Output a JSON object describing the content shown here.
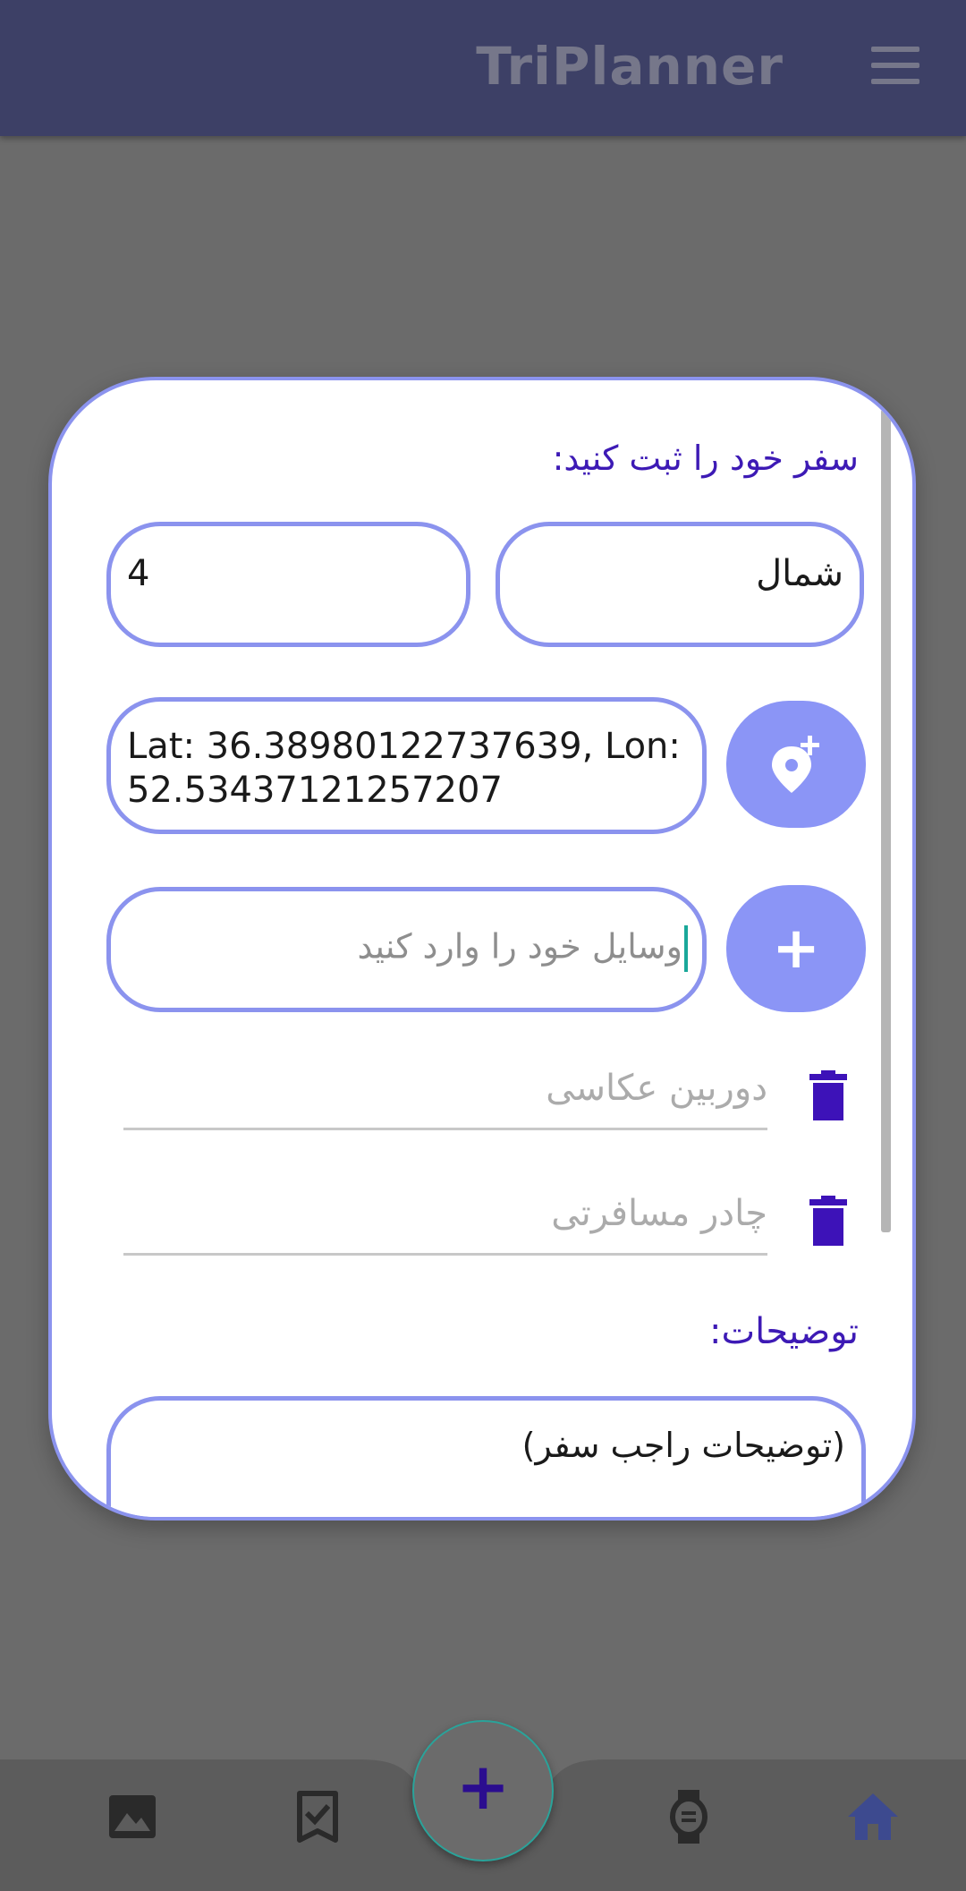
{
  "app": {
    "title": "TriPlanner"
  },
  "form": {
    "heading": "سفر خود را ثبت کنید:",
    "destination_value": "شمال",
    "count_value": "4",
    "location_value": "Lat: 36.38980122737639, Lon: 52.53437121257207",
    "item_placeholder": "وسایل خود را وارد کنید",
    "items": [
      {
        "label": "دوربین عکاسی"
      },
      {
        "label": "چادر مسافرتی"
      }
    ],
    "description_label": "توضیحات:",
    "description_value": "(توضیحات راجب سفر)"
  },
  "colors": {
    "appbar": "#3d4066",
    "accent": "#8b95f6",
    "border": "#8b93ee",
    "heading_text": "#3d1ab5",
    "trash": "#3d12b8",
    "overlay": "#6b6b6b"
  },
  "nav": {
    "items": [
      {
        "icon": "image-icon"
      },
      {
        "icon": "checklist-icon"
      },
      {
        "icon": "add-icon"
      },
      {
        "icon": "watch-icon"
      },
      {
        "icon": "home-icon"
      }
    ]
  }
}
